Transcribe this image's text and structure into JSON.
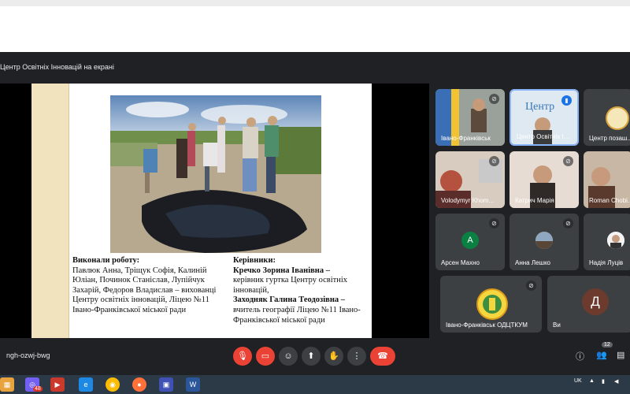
{
  "meeting": {
    "presenting_title": "Центр Освітніх Інновацій на екрані",
    "code": "ngh-ozwj-bwg",
    "participants_count": "12"
  },
  "slide": {
    "left_heading": "Виконали роботу:",
    "left_body": "Павлюк Анна, Тріщук Софія, Калиній Юліан, Починок Станіслав, Лупійчук Захарій, Федоров Владислав – вихованці Центру освітніх інновацій, Ліцею №11 Івано-Франківської міської ради",
    "right_heading": "Керівники:",
    "person1_name": "Кречко Зорина Іванівна –",
    "person1_role": "керівник гуртка Центру освітніх інновацій,",
    "person2_name": "Заходняк Галина Теодозівна –",
    "person2_role": "вчитель географії Ліцею №11 Івано-Франківської міської ради"
  },
  "participants": [
    {
      "name": "Івано-Франківськ",
      "muted": true
    },
    {
      "name": "Центр Освітніх І...",
      "muted": false,
      "speaking": true,
      "logo_text": "Центр"
    },
    {
      "name": "Центр позаш..."
    },
    {
      "name": "Volodymyr Khom...",
      "muted": true
    },
    {
      "name": "Катрич Марія",
      "muted": true
    },
    {
      "name": "Roman Chobi..."
    },
    {
      "name": "Арсен Махно",
      "muted": true,
      "initial": "A",
      "color": "#0b8043"
    },
    {
      "name": "Анна Лешко",
      "muted": true
    },
    {
      "name": "Надія Луців"
    },
    {
      "name": "Івано-Франківськ ОДЦТКУМ",
      "muted": true
    },
    {
      "name": "Ви",
      "initial": "Д",
      "color": "#6d3b2e"
    }
  ],
  "taskbar": {
    "lang": "UK",
    "badge": "48"
  },
  "colors": {
    "meet_bg": "#202124",
    "tile_bg": "#3c4043",
    "danger": "#ea4335",
    "taskbar": "#2c3a47"
  },
  "icons": [
    "mic-off-icon",
    "camera-off-icon",
    "emoji-icon",
    "present-icon",
    "hand-icon",
    "more-icon",
    "hangup-icon",
    "info-icon",
    "people-icon",
    "chat-icon"
  ]
}
